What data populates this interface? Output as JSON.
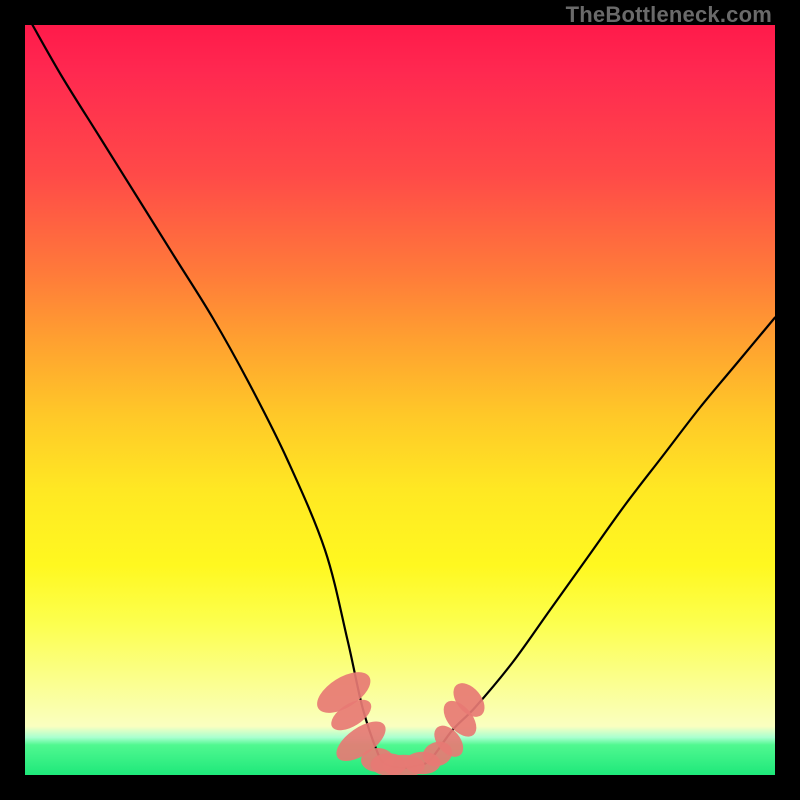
{
  "watermark": "TheBottleneck.com",
  "chart_data": {
    "type": "line",
    "title": "",
    "xlabel": "",
    "ylabel": "",
    "xlim": [
      0,
      100
    ],
    "ylim": [
      0,
      100
    ],
    "grid": false,
    "series": [
      {
        "name": "bottleneck-curve",
        "x": [
          1,
          5,
          10,
          15,
          20,
          25,
          30,
          35,
          40,
          43,
          45,
          47,
          48,
          50,
          52,
          54,
          57,
          60,
          65,
          70,
          75,
          80,
          85,
          90,
          95,
          100
        ],
        "values": [
          100,
          93,
          85,
          77,
          69,
          61,
          52,
          42,
          30,
          18,
          9,
          3,
          1.5,
          1,
          1.2,
          2,
          6,
          9,
          15,
          22,
          29,
          36,
          42.5,
          49,
          55,
          61
        ]
      }
    ],
    "markers": [
      {
        "x": 42.5,
        "y": 11,
        "rx": 2.0,
        "ry": 4.0,
        "rot": 58
      },
      {
        "x": 43.5,
        "y": 8,
        "rx": 1.5,
        "ry": 3.0,
        "rot": 58
      },
      {
        "x": 44.8,
        "y": 4.5,
        "rx": 1.8,
        "ry": 3.8,
        "rot": 55
      },
      {
        "x": 47.0,
        "y": 2.0,
        "rx": 2.2,
        "ry": 1.6,
        "rot": 0
      },
      {
        "x": 48.5,
        "y": 1.4,
        "rx": 2.4,
        "ry": 1.5,
        "rot": 0
      },
      {
        "x": 50.5,
        "y": 1.2,
        "rx": 2.8,
        "ry": 1.5,
        "rot": 0
      },
      {
        "x": 53.0,
        "y": 1.6,
        "rx": 2.4,
        "ry": 1.5,
        "rot": 0
      },
      {
        "x": 55.0,
        "y": 2.8,
        "rx": 2.0,
        "ry": 1.6,
        "rot": -18
      },
      {
        "x": 56.5,
        "y": 4.5,
        "rx": 1.5,
        "ry": 2.4,
        "rot": -40
      },
      {
        "x": 58.0,
        "y": 7.5,
        "rx": 1.6,
        "ry": 2.8,
        "rot": -40
      },
      {
        "x": 59.2,
        "y": 10.0,
        "rx": 1.6,
        "ry": 2.6,
        "rot": -40
      }
    ],
    "marker_color": "#e77a74",
    "line_color": "#000000"
  }
}
